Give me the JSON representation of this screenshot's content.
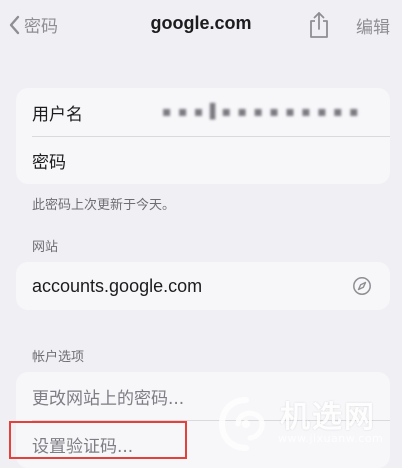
{
  "nav": {
    "back_label": "密码",
    "title": "google.com",
    "edit_label": "编辑"
  },
  "credentials": {
    "username_label": "用户名",
    "username_value": "▪ ▪ ▪ ▌▪ ▪ ▪  ▪ ▪ ▪ ▪ ▪ ▪",
    "password_label": "密码"
  },
  "note": "此密码上次更新于今天。",
  "website": {
    "header": "网站",
    "url": "accounts.google.com"
  },
  "account_options": {
    "header": "帐户选项",
    "change_password": "更改网站上的密码...",
    "set_verification_code": "设置验证码..."
  },
  "watermark": {
    "text": "机选网",
    "url": "www.jixuanw.com"
  },
  "colors": {
    "background": "#efeff4",
    "card": "#f7f7fa",
    "highlight": "#e5413c"
  }
}
